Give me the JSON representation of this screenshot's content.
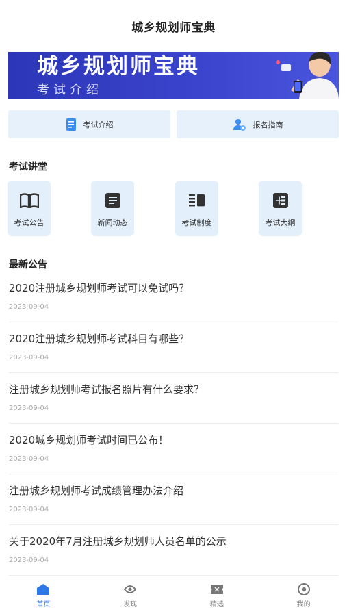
{
  "header": {
    "title": "城乡规划师宝典"
  },
  "banner": {
    "title": "城乡规划师宝典",
    "subtitle": "考试介绍"
  },
  "quick": [
    {
      "label": "考试介绍",
      "icon": "document-icon"
    },
    {
      "label": "报名指南",
      "icon": "user-gear-icon"
    }
  ],
  "lecture": {
    "title": "考试讲堂",
    "items": [
      {
        "label": "考试公告",
        "icon": "book-icon"
      },
      {
        "label": "新闻动态",
        "icon": "news-icon"
      },
      {
        "label": "考试制度",
        "icon": "list-icon"
      },
      {
        "label": "考试大纲",
        "icon": "outline-icon"
      }
    ]
  },
  "news": {
    "title": "最新公告",
    "items": [
      {
        "title": "2020注册城乡规划师考试可以免试吗？",
        "date": "2023-09-04"
      },
      {
        "title": "2020注册城乡规划师考试科目有哪些？",
        "date": "2023-09-04"
      },
      {
        "title": "注册城乡规划师考试报名照片有什么要求？",
        "date": "2023-09-04"
      },
      {
        "title": "2020城乡规划师考试时间已公布！",
        "date": "2023-09-04"
      },
      {
        "title": "注册城乡规划师考试成绩管理办法介绍",
        "date": "2023-09-04"
      },
      {
        "title": "关于2020年7月注册城乡规划师人员名单的公示",
        "date": "2023-09-04"
      }
    ]
  },
  "tabbar": {
    "active_color": "#2e78e6",
    "items": [
      {
        "label": "首页",
        "icon": "home-icon"
      },
      {
        "label": "发现",
        "icon": "eye-icon"
      },
      {
        "label": "精选",
        "icon": "ticket-icon"
      },
      {
        "label": "我的",
        "icon": "profile-icon"
      }
    ]
  }
}
